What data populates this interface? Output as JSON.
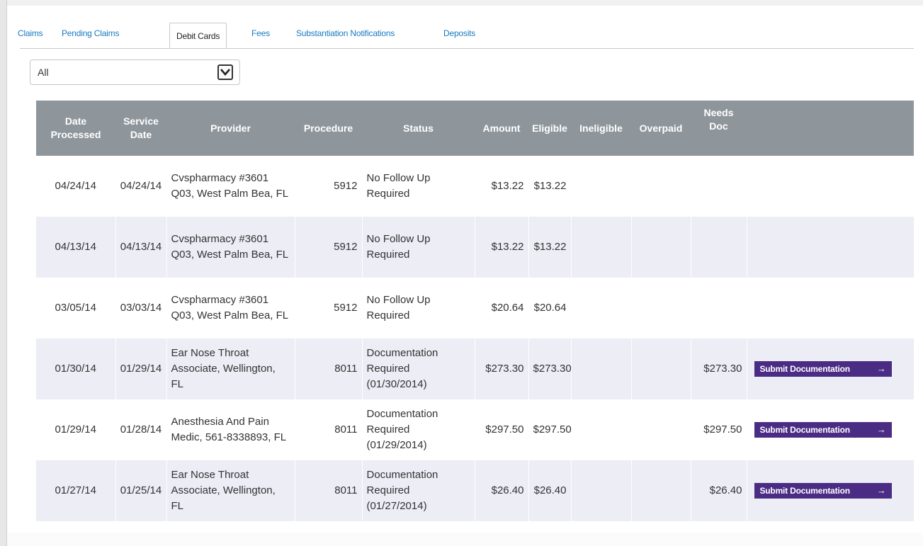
{
  "tabs": [
    {
      "label": "Claims"
    },
    {
      "label": "Pending Claims"
    },
    {
      "label": "Debit Cards",
      "active": true
    },
    {
      "label": "Fees"
    },
    {
      "label": "Substantiation Notifications"
    },
    {
      "label": "Deposits"
    }
  ],
  "filter": {
    "selected": "All",
    "icon": "chevron-down-icon"
  },
  "table": {
    "headers": {
      "date_processed": "Date Processed",
      "service_date": "Service Date",
      "provider": "Provider",
      "procedure": "Procedure",
      "status": "Status",
      "amount": "Amount",
      "eligible": "Eligible",
      "ineligible": "Ineligible",
      "overpaid": "Overpaid",
      "needs_doc": "Needs Doc"
    },
    "rows": [
      {
        "date_processed": "04/24/14",
        "service_date": "04/24/14",
        "provider": "Cvspharmacy #3601 Q03, West Palm Bea, FL",
        "procedure": "5912",
        "status": "No Follow Up Required",
        "amount": "$13.22",
        "eligible": "$13.22",
        "ineligible": "",
        "overpaid": "",
        "needs_doc": "",
        "action": ""
      },
      {
        "date_processed": "04/13/14",
        "service_date": "04/13/14",
        "provider": "Cvspharmacy #3601 Q03, West Palm Bea, FL",
        "procedure": "5912",
        "status": "No Follow Up Required",
        "amount": "$13.22",
        "eligible": "$13.22",
        "ineligible": "",
        "overpaid": "",
        "needs_doc": "",
        "action": ""
      },
      {
        "date_processed": "03/05/14",
        "service_date": "03/03/14",
        "provider": "Cvspharmacy #3601 Q03, West Palm Bea, FL",
        "procedure": "5912",
        "status": "No Follow Up Required",
        "amount": "$20.64",
        "eligible": "$20.64",
        "ineligible": "",
        "overpaid": "",
        "needs_doc": "",
        "action": ""
      },
      {
        "date_processed": "01/30/14",
        "service_date": "01/29/14",
        "provider": "Ear Nose Throat Associate, Wellington, FL",
        "procedure": "8011",
        "status": "Documentation Required (01/30/2014)",
        "amount": "$273.30",
        "eligible": "$273.30",
        "ineligible": "",
        "overpaid": "",
        "needs_doc": "$273.30",
        "action": "Submit Documentation"
      },
      {
        "date_processed": "01/29/14",
        "service_date": "01/28/14",
        "provider": "Anesthesia And Pain Medic, 561-8338893, FL",
        "procedure": "8011",
        "status": "Documentation Required (01/29/2014)",
        "amount": "$297.50",
        "eligible": "$297.50",
        "ineligible": "",
        "overpaid": "",
        "needs_doc": "$297.50",
        "action": "Submit Documentation"
      },
      {
        "date_processed": "01/27/14",
        "service_date": "01/25/14",
        "provider": "Ear Nose Throat Associate, Wellington, FL",
        "procedure": "8011",
        "status": "Documentation Required (01/27/2014)",
        "amount": "$26.40",
        "eligible": "$26.40",
        "ineligible": "",
        "overpaid": "",
        "needs_doc": "$26.40",
        "action": "Submit Documentation"
      }
    ]
  },
  "colors": {
    "header_bg": "#8f969b",
    "alt_row": "#ecedf5",
    "button": "#4b2c85",
    "tab_link": "#1a7bc0"
  }
}
